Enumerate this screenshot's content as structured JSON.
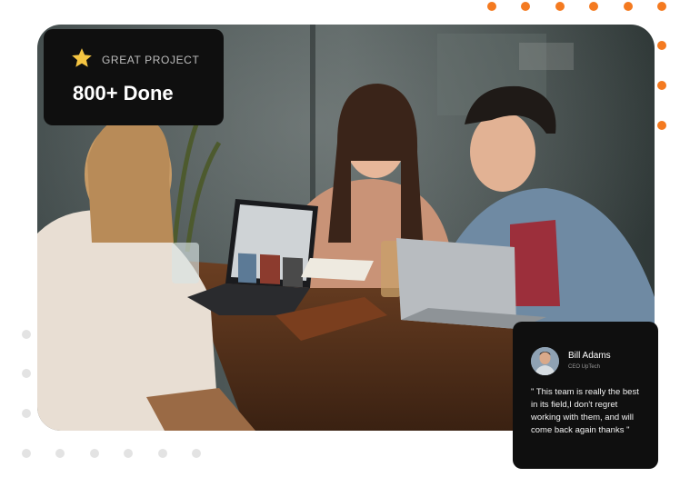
{
  "project_badge": {
    "label": "GREAT PROJECT",
    "count": "800+ Done",
    "icon": "star-icon",
    "icon_color": "#F5C542"
  },
  "testimonial": {
    "name": "Bill Adams",
    "role": "CEO UpTech",
    "quote": "\" This team is really the best in its field,I don't regret working with them, and will come back again thanks \"",
    "avatar": "avatar-photo"
  },
  "photo": {
    "name": "team-meeting-photo"
  },
  "colors": {
    "accent": "#F47A20",
    "card_background": "#0F0F0F",
    "decor_dots": "#E3E3E3"
  }
}
